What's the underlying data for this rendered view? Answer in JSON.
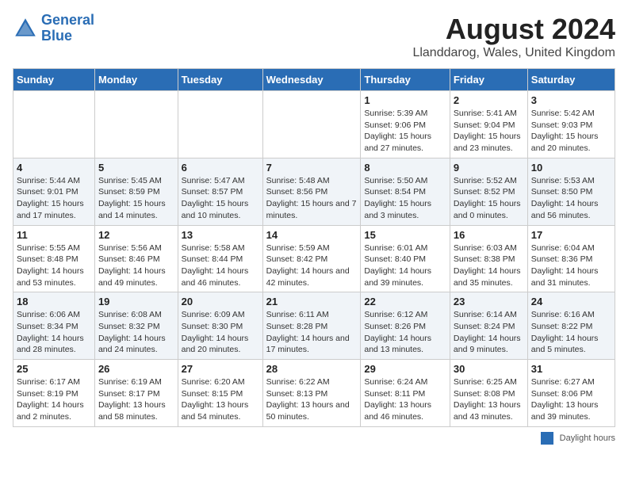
{
  "header": {
    "logo_line1": "General",
    "logo_line2": "Blue",
    "title": "August 2024",
    "subtitle": "Llanddarog, Wales, United Kingdom"
  },
  "days_of_week": [
    "Sunday",
    "Monday",
    "Tuesday",
    "Wednesday",
    "Thursday",
    "Friday",
    "Saturday"
  ],
  "weeks": [
    [
      {
        "day": "",
        "info": ""
      },
      {
        "day": "",
        "info": ""
      },
      {
        "day": "",
        "info": ""
      },
      {
        "day": "",
        "info": ""
      },
      {
        "day": "1",
        "info": "Sunrise: 5:39 AM\nSunset: 9:06 PM\nDaylight: 15 hours\nand 27 minutes."
      },
      {
        "day": "2",
        "info": "Sunrise: 5:41 AM\nSunset: 9:04 PM\nDaylight: 15 hours\nand 23 minutes."
      },
      {
        "day": "3",
        "info": "Sunrise: 5:42 AM\nSunset: 9:03 PM\nDaylight: 15 hours\nand 20 minutes."
      }
    ],
    [
      {
        "day": "4",
        "info": "Sunrise: 5:44 AM\nSunset: 9:01 PM\nDaylight: 15 hours\nand 17 minutes."
      },
      {
        "day": "5",
        "info": "Sunrise: 5:45 AM\nSunset: 8:59 PM\nDaylight: 15 hours\nand 14 minutes."
      },
      {
        "day": "6",
        "info": "Sunrise: 5:47 AM\nSunset: 8:57 PM\nDaylight: 15 hours\nand 10 minutes."
      },
      {
        "day": "7",
        "info": "Sunrise: 5:48 AM\nSunset: 8:56 PM\nDaylight: 15 hours\nand 7 minutes."
      },
      {
        "day": "8",
        "info": "Sunrise: 5:50 AM\nSunset: 8:54 PM\nDaylight: 15 hours\nand 3 minutes."
      },
      {
        "day": "9",
        "info": "Sunrise: 5:52 AM\nSunset: 8:52 PM\nDaylight: 15 hours\nand 0 minutes."
      },
      {
        "day": "10",
        "info": "Sunrise: 5:53 AM\nSunset: 8:50 PM\nDaylight: 14 hours\nand 56 minutes."
      }
    ],
    [
      {
        "day": "11",
        "info": "Sunrise: 5:55 AM\nSunset: 8:48 PM\nDaylight: 14 hours\nand 53 minutes."
      },
      {
        "day": "12",
        "info": "Sunrise: 5:56 AM\nSunset: 8:46 PM\nDaylight: 14 hours\nand 49 minutes."
      },
      {
        "day": "13",
        "info": "Sunrise: 5:58 AM\nSunset: 8:44 PM\nDaylight: 14 hours\nand 46 minutes."
      },
      {
        "day": "14",
        "info": "Sunrise: 5:59 AM\nSunset: 8:42 PM\nDaylight: 14 hours\nand 42 minutes."
      },
      {
        "day": "15",
        "info": "Sunrise: 6:01 AM\nSunset: 8:40 PM\nDaylight: 14 hours\nand 39 minutes."
      },
      {
        "day": "16",
        "info": "Sunrise: 6:03 AM\nSunset: 8:38 PM\nDaylight: 14 hours\nand 35 minutes."
      },
      {
        "day": "17",
        "info": "Sunrise: 6:04 AM\nSunset: 8:36 PM\nDaylight: 14 hours\nand 31 minutes."
      }
    ],
    [
      {
        "day": "18",
        "info": "Sunrise: 6:06 AM\nSunset: 8:34 PM\nDaylight: 14 hours\nand 28 minutes."
      },
      {
        "day": "19",
        "info": "Sunrise: 6:08 AM\nSunset: 8:32 PM\nDaylight: 14 hours\nand 24 minutes."
      },
      {
        "day": "20",
        "info": "Sunrise: 6:09 AM\nSunset: 8:30 PM\nDaylight: 14 hours\nand 20 minutes."
      },
      {
        "day": "21",
        "info": "Sunrise: 6:11 AM\nSunset: 8:28 PM\nDaylight: 14 hours\nand 17 minutes."
      },
      {
        "day": "22",
        "info": "Sunrise: 6:12 AM\nSunset: 8:26 PM\nDaylight: 14 hours\nand 13 minutes."
      },
      {
        "day": "23",
        "info": "Sunrise: 6:14 AM\nSunset: 8:24 PM\nDaylight: 14 hours\nand 9 minutes."
      },
      {
        "day": "24",
        "info": "Sunrise: 6:16 AM\nSunset: 8:22 PM\nDaylight: 14 hours\nand 5 minutes."
      }
    ],
    [
      {
        "day": "25",
        "info": "Sunrise: 6:17 AM\nSunset: 8:19 PM\nDaylight: 14 hours\nand 2 minutes."
      },
      {
        "day": "26",
        "info": "Sunrise: 6:19 AM\nSunset: 8:17 PM\nDaylight: 13 hours\nand 58 minutes."
      },
      {
        "day": "27",
        "info": "Sunrise: 6:20 AM\nSunset: 8:15 PM\nDaylight: 13 hours\nand 54 minutes."
      },
      {
        "day": "28",
        "info": "Sunrise: 6:22 AM\nSunset: 8:13 PM\nDaylight: 13 hours\nand 50 minutes."
      },
      {
        "day": "29",
        "info": "Sunrise: 6:24 AM\nSunset: 8:11 PM\nDaylight: 13 hours\nand 46 minutes."
      },
      {
        "day": "30",
        "info": "Sunrise: 6:25 AM\nSunset: 8:08 PM\nDaylight: 13 hours\nand 43 minutes."
      },
      {
        "day": "31",
        "info": "Sunrise: 6:27 AM\nSunset: 8:06 PM\nDaylight: 13 hours\nand 39 minutes."
      }
    ]
  ],
  "footer": {
    "legend_label": "Daylight hours"
  }
}
